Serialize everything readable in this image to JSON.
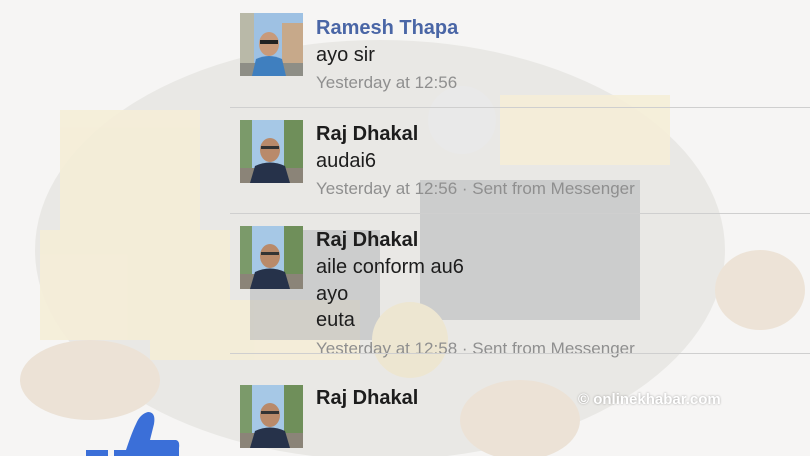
{
  "watermark": "© onlinekhabar.com",
  "colors": {
    "sender_primary": "#4a66a6",
    "sender": "#1d1d1d",
    "meta": "#8f8f8f",
    "like": "#3b6fd8"
  },
  "messages": [
    {
      "sender": "Ramesh Thapa",
      "lines": [
        "ayo sir"
      ],
      "meta": "Yesterday at 12:56"
    },
    {
      "sender": "Raj Dhakal",
      "lines": [
        "audai6"
      ],
      "meta": "Yesterday at 12:56 · Sent from Messenger"
    },
    {
      "sender": "Raj Dhakal",
      "lines": [
        "aile conform au6",
        "ayo",
        "euta"
      ],
      "meta": "Yesterday at 12:58 · Sent from Messenger"
    },
    {
      "sender": "Raj Dhakal",
      "content_icon": "thumbs-up-icon"
    }
  ]
}
